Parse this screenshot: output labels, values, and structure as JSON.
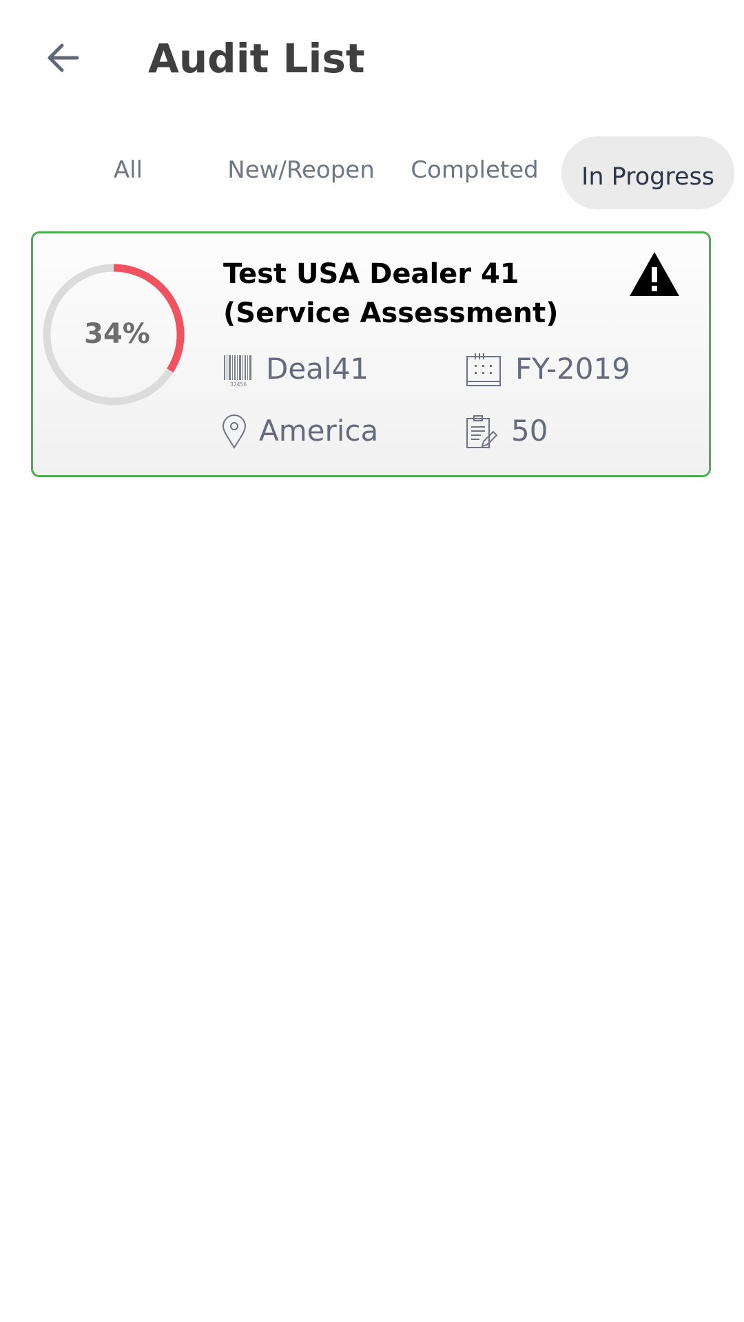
{
  "header": {
    "title": "Audit List",
    "back_icon": "arrow-left-icon"
  },
  "tabs": [
    {
      "label": "All",
      "active": false
    },
    {
      "label": "New/Reopen",
      "active": false
    },
    {
      "label": "Completed",
      "active": false
    },
    {
      "label": "In Progress",
      "active": true
    }
  ],
  "audits": [
    {
      "progress_percent": 34,
      "progress_label": "34%",
      "title_line1": "Test USA Dealer 41",
      "title_line2": "(Service Assessment)",
      "warning_icon": "warning-triangle-icon",
      "dealer_code": "Deal41",
      "fiscal_year": "FY-2019",
      "region": "America",
      "question_count": "50"
    }
  ],
  "colors": {
    "accent_border": "#4caf50",
    "progress": "#f0525f",
    "track": "#dcdcdc",
    "active_tab_bg": "#ebebeb"
  }
}
